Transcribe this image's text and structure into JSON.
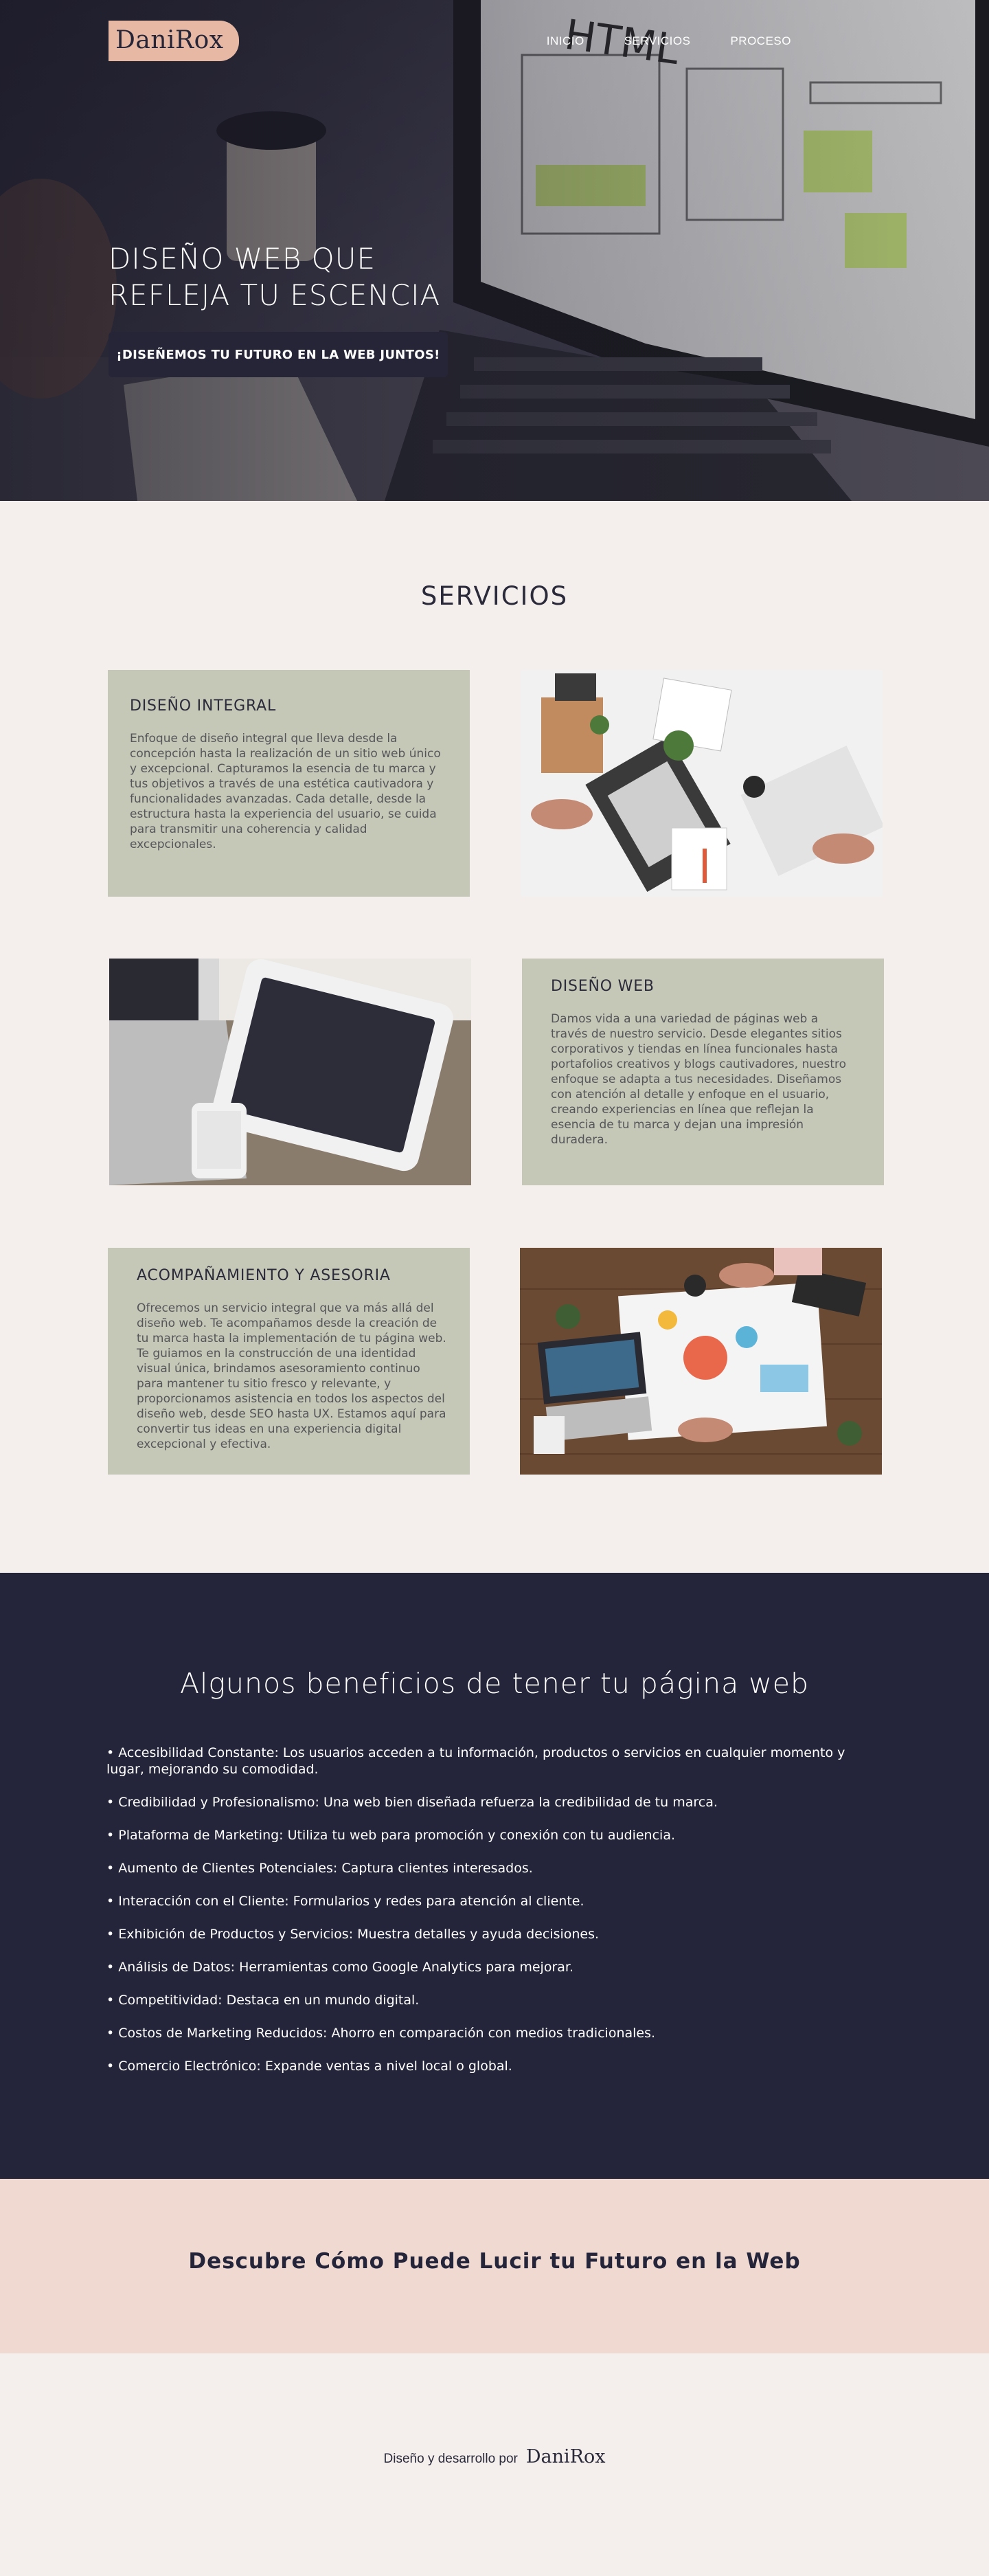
{
  "header": {
    "logo": "DaniRox",
    "nav": [
      {
        "label": "INICIO"
      },
      {
        "label": "SERVICIOS"
      },
      {
        "label": "PROCESO"
      }
    ]
  },
  "hero": {
    "title": "DISEÑO WEB QUE REFLEJA TU ESCENCIA",
    "cta": "¡DISEÑEMOS TU FUTURO EN LA WEB JUNTOS!"
  },
  "services": {
    "title": "SERVICIOS",
    "items": [
      {
        "title": "DISEÑO INTEGRAL",
        "text": "Enfoque de diseño integral que lleva desde la concepción hasta la realización de un sitio web único y excepcional. Capturamos la esencia de tu marca y tus objetivos a través de una estética cautivadora y funcionalidades avanzadas. Cada detalle, desde la estructura hasta la experiencia del usuario, se cuida para transmitir una coherencia y calidad excepcionales."
      },
      {
        "title": "DISEÑO WEB",
        "text": "Damos vida a una variedad de páginas web a través de nuestro servicio. Desde elegantes sitios corporativos y tiendas en línea funcionales hasta portafolios creativos y blogs cautivadores, nuestro enfoque se adapta a tus necesidades. Diseñamos con atención al detalle y enfoque en el usuario, creando experiencias en línea que reflejan la esencia de tu marca y dejan una impresión duradera."
      },
      {
        "title": "ACOMPAÑAMIENTO Y ASESORIA",
        "text": "Ofrecemos un servicio integral que va más allá del diseño web. Te acompañamos desde la creación de tu marca hasta la implementación de tu página web. Te guiamos en la construcción de una identidad visual única, brindamos asesoramiento continuo para mantener tu sitio fresco y relevante, y proporcionamos asistencia en todos los aspectos del diseño web, desde SEO hasta UX. Estamos aquí para convertir tus ideas en una experiencia digital excepcional y efectiva."
      }
    ]
  },
  "benefits": {
    "title": "Algunos beneficios de  tener tu página web",
    "items": [
      "• Accesibilidad Constante: Los usuarios acceden a tu información, productos o servicios en cualquier momento y lugar, mejorando su comodidad.",
      "• Credibilidad y Profesionalismo: Una web bien diseñada refuerza la credibilidad de tu marca.",
      "• Plataforma de Marketing: Utiliza tu web para promoción y conexión con tu audiencia.",
      "• Aumento de Clientes Potenciales: Captura clientes interesados.",
      "• Interacción con el Cliente: Formularios y redes para atención al cliente.",
      "• Exhibición de Productos y Servicios: Muestra detalles y ayuda decisiones.",
      "• Análisis de Datos: Herramientas como Google Analytics para mejorar.",
      "• Competitividad: Destaca en un mundo digital.",
      "• Costos de Marketing Reducidos: Ahorro en comparación con medios tradicionales.",
      "• Comercio Electrónico: Expande ventas a nivel local o global."
    ]
  },
  "discover": {
    "title": "Descubre Cómo Puede Lucir tu Futuro en la Web"
  },
  "footer": {
    "text": "Diseño y desarrollo por",
    "logo": "DaniRox"
  }
}
